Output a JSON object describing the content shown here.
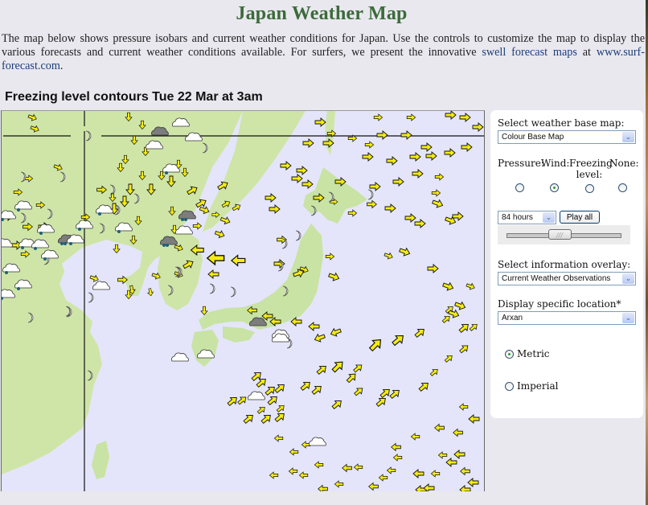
{
  "page": {
    "title": "Japan Weather Map",
    "intro_text": "The map below shows pressure isobars and current weather conditions for Japan. Use the controls to customize the map to display the various forecasts and current weather conditions available. For surfers, we present the innovative ",
    "intro_link": "swell forecast maps",
    "intro_suffix_pre": " at ",
    "intro_site_link": "www.surf-forecast.com",
    "intro_end": ".",
    "map_heading": "Freezing level contours Tue 22 Mar at 3am"
  },
  "panel": {
    "base_map_label": "Select weather base map:",
    "base_map_value": "Colour Base Map",
    "layer_options": [
      {
        "label": "Pressure:",
        "checked": false
      },
      {
        "label": "Wind:",
        "checked": true
      },
      {
        "label": "Freezing level:",
        "checked": false
      },
      {
        "label": "None:",
        "checked": false
      }
    ],
    "hours_value": "84 hours",
    "play_label": "Play all",
    "slider_position": 0.46,
    "overlay_label": "Select information overlay:",
    "overlay_value": "Current Weather Observations",
    "location_label": "Display specific location*",
    "location_value": "Arxan",
    "units": [
      {
        "label": "Metric",
        "checked": true
      },
      {
        "label": "Imperial",
        "checked": false
      }
    ]
  },
  "map": {
    "colors": {
      "sea": "#e4e5fa",
      "land": "#c8e3a4",
      "arrow": "#f5ec10",
      "arrow_outline": "#111111"
    },
    "icons": {
      "wind_arrow": "wind-arrow-icon",
      "moon": "clear-night-moon-icon",
      "cloud": "cloud-icon",
      "rain_cloud": "rain-cloud-icon",
      "dark_cloud": "overcast-cloud-icon"
    }
  }
}
